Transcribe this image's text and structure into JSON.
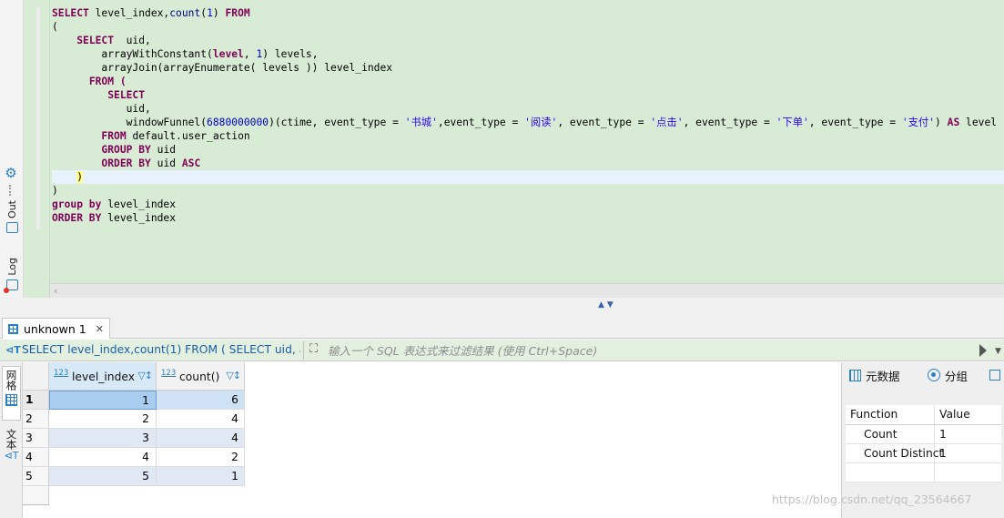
{
  "side_tabs": {
    "output": "Out",
    "log": "Log"
  },
  "editor": {
    "lines": [
      [
        {
          "t": "SELECT",
          "c": "kw"
        },
        {
          "t": " level_index,"
        },
        {
          "t": "count",
          "c": "fn"
        },
        {
          "t": "("
        },
        {
          "t": "1",
          "c": "num"
        },
        {
          "t": ") "
        },
        {
          "t": "FROM",
          "c": "kw"
        }
      ],
      [
        {
          "t": "("
        }
      ],
      [
        {
          "t": "    "
        },
        {
          "t": "SELECT",
          "c": "kw"
        },
        {
          "t": "  uid,"
        }
      ],
      [
        {
          "t": "        arrayWithConstant("
        },
        {
          "t": "level",
          "c": "kw"
        },
        {
          "t": ", "
        },
        {
          "t": "1",
          "c": "num"
        },
        {
          "t": ") levels,"
        }
      ],
      [
        {
          "t": "        arrayJoin(arrayEnumerate( levels )) level_index"
        }
      ],
      [
        {
          "t": "      "
        },
        {
          "t": "FROM (",
          "c": "kw"
        }
      ],
      [
        {
          "t": "         "
        },
        {
          "t": "SELECT",
          "c": "kw"
        }
      ],
      [
        {
          "t": "            uid,"
        }
      ],
      [
        {
          "t": "            windowFunnel("
        },
        {
          "t": "6880000000",
          "c": "num"
        },
        {
          "t": ")(ctime, event_type = "
        },
        {
          "t": "'书城'",
          "c": "str"
        },
        {
          "t": ",event_type = "
        },
        {
          "t": "'阅读'",
          "c": "str"
        },
        {
          "t": ", event_type = "
        },
        {
          "t": "'点击'",
          "c": "str"
        },
        {
          "t": ", event_type = "
        },
        {
          "t": "'下单'",
          "c": "str"
        },
        {
          "t": ", event_type = "
        },
        {
          "t": "'支付'",
          "c": "str"
        },
        {
          "t": ") "
        },
        {
          "t": "AS",
          "c": "kw"
        },
        {
          "t": " level"
        }
      ],
      [
        {
          "t": "        "
        },
        {
          "t": "FROM",
          "c": "kw"
        },
        {
          "t": " default.user_action"
        }
      ],
      [
        {
          "t": "        "
        },
        {
          "t": "GROUP BY",
          "c": "kw"
        },
        {
          "t": " uid"
        }
      ],
      [
        {
          "t": "        "
        },
        {
          "t": "ORDER BY",
          "c": "kw"
        },
        {
          "t": " uid "
        },
        {
          "t": "ASC",
          "c": "kw"
        }
      ],
      [
        {
          "t": "    "
        },
        {
          "t": ")",
          "c": "hl"
        }
      ],
      [
        {
          "t": ")"
        }
      ],
      [
        {
          "t": "group by",
          "c": "kw"
        },
        {
          "t": " level_index"
        }
      ],
      [
        {
          "t": "ORDER BY",
          "c": "kw"
        },
        {
          "t": " level_index"
        }
      ]
    ],
    "current_line": 12
  },
  "results": {
    "tab_label": "unknown 1",
    "tab_close": "✕",
    "query_preview": "SELECT level_index,count(1) FROM ( SELECT uid, arrayWi",
    "filter_placeholder": "输入一个 SQL 表达式来过滤结果 (使用 Ctrl+Space)",
    "view_tabs": {
      "grid": "网格",
      "text": "文本"
    },
    "columns": [
      {
        "type_icon": "123",
        "name": "level_index"
      },
      {
        "type_icon": "123",
        "name": "count()"
      }
    ],
    "rows": [
      {
        "n": "1",
        "level_index": "1",
        "count": "6"
      },
      {
        "n": "2",
        "level_index": "2",
        "count": "4"
      },
      {
        "n": "3",
        "level_index": "3",
        "count": "4"
      },
      {
        "n": "4",
        "level_index": "4",
        "count": "2"
      },
      {
        "n": "5",
        "level_index": "5",
        "count": "1"
      }
    ],
    "selected_row": 0
  },
  "panel": {
    "tab_metadata": "元数据",
    "tab_grouping": "分组",
    "table_header": {
      "function": "Function",
      "value": "Value"
    },
    "rows": [
      {
        "function": "Count",
        "value": "1"
      },
      {
        "function": "Count Distinct",
        "value": "1"
      }
    ]
  },
  "watermark": "https://blog.csdn.net/qq_23564667",
  "colors": {
    "editor_bg": "#d8ecd5",
    "keyword": "#7f0055",
    "number": "#0000cc",
    "accent": "#2a7fc9",
    "selection": "#a9cdef"
  }
}
